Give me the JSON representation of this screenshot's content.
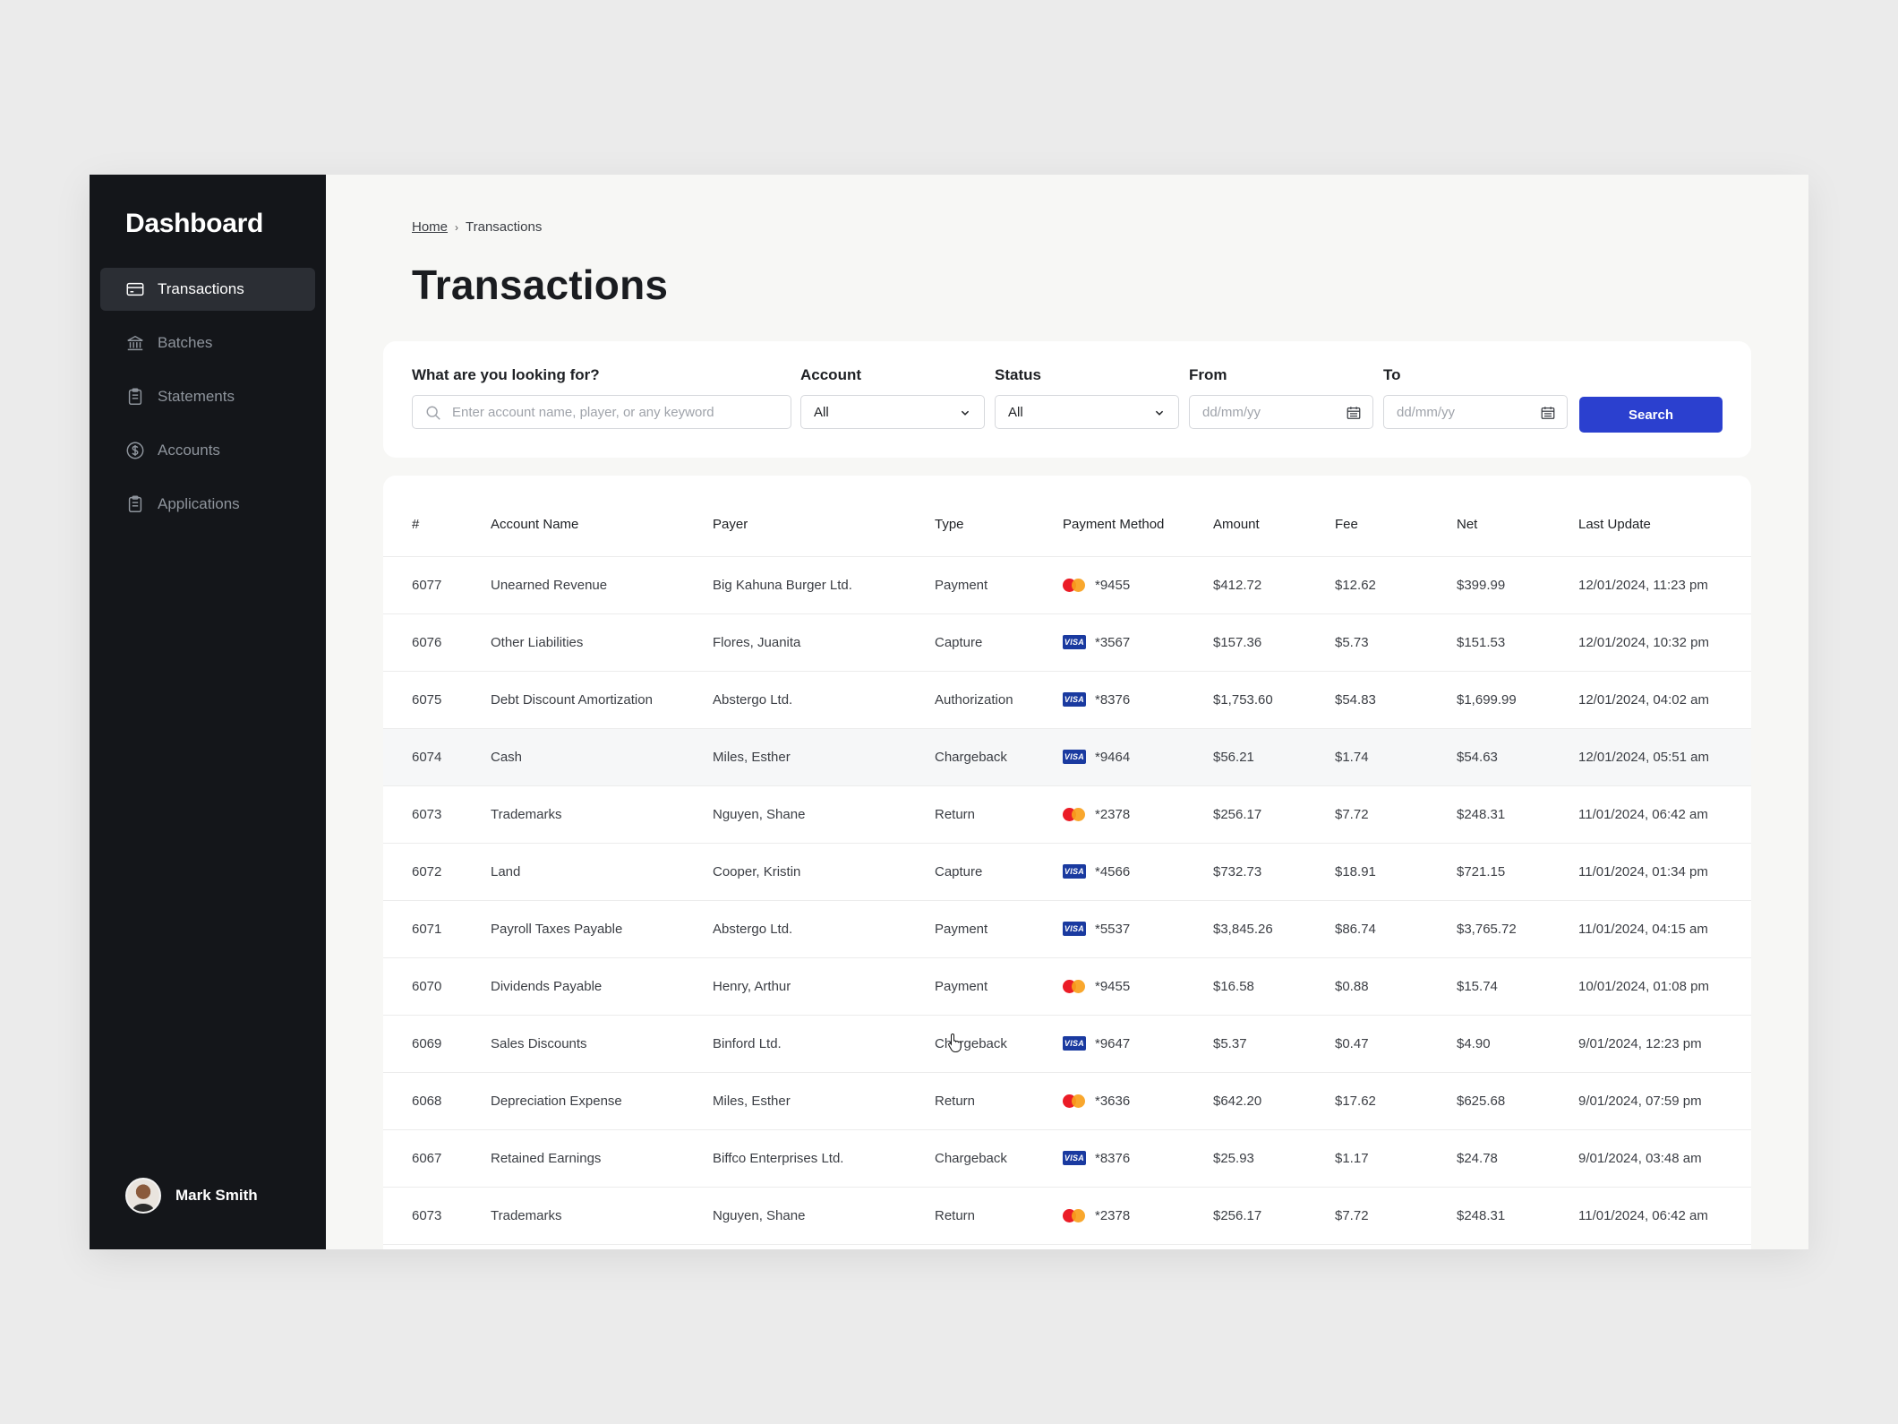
{
  "sidebar": {
    "brand": "Dashboard",
    "items": [
      {
        "label": "Transactions",
        "icon": "card-icon",
        "active": true
      },
      {
        "label": "Batches",
        "icon": "bank-icon",
        "active": false
      },
      {
        "label": "Statements",
        "icon": "clipboard-icon",
        "active": false
      },
      {
        "label": "Accounts",
        "icon": "dollar-circle-icon",
        "active": false
      },
      {
        "label": "Applications",
        "icon": "clipboard-icon",
        "active": false
      }
    ],
    "user": {
      "name": "Mark Smith"
    }
  },
  "breadcrumb": {
    "home": "Home",
    "current": "Transactions"
  },
  "page_title": "Transactions",
  "filters": {
    "search": {
      "label": "What are you looking for?",
      "placeholder": "Enter account name, player, or any keyword",
      "value": ""
    },
    "account": {
      "label": "Account",
      "value": "All"
    },
    "status": {
      "label": "Status",
      "value": "All"
    },
    "from": {
      "label": "From",
      "placeholder": "dd/mm/yy"
    },
    "to": {
      "label": "To",
      "placeholder": "dd/mm/yy"
    },
    "search_button": "Search"
  },
  "table": {
    "columns": [
      "#",
      "Account Name",
      "Payer",
      "Type",
      "Payment Method",
      "Amount",
      "Fee",
      "Net",
      "Last Update"
    ],
    "rows": [
      {
        "id": "6077",
        "account": "Unearned Revenue",
        "payer": "Big Kahuna Burger Ltd.",
        "type": "Payment",
        "card": "mastercard",
        "last4": "*9455",
        "amount": "$412.72",
        "fee": "$12.62",
        "net": "$399.99",
        "updated": "12/01/2024, 11:23 pm"
      },
      {
        "id": "6076",
        "account": "Other Liabilities",
        "payer": "Flores, Juanita",
        "type": "Capture",
        "card": "visa",
        "last4": "*3567",
        "amount": "$157.36",
        "fee": "$5.73",
        "net": "$151.53",
        "updated": "12/01/2024, 10:32 pm"
      },
      {
        "id": "6075",
        "account": "Debt Discount Amortization",
        "payer": "Abstergo Ltd.",
        "type": "Authorization",
        "card": "visa",
        "last4": "*8376",
        "amount": "$1,753.60",
        "fee": "$54.83",
        "net": "$1,699.99",
        "updated": "12/01/2024, 04:02 am"
      },
      {
        "id": "6074",
        "account": "Cash",
        "payer": "Miles, Esther",
        "type": "Chargeback",
        "card": "visa",
        "last4": "*9464",
        "amount": "$56.21",
        "fee": "$1.74",
        "net": "$54.63",
        "updated": "12/01/2024, 05:51 am",
        "hover": true
      },
      {
        "id": "6073",
        "account": "Trademarks",
        "payer": "Nguyen, Shane",
        "type": "Return",
        "card": "mastercard",
        "last4": "*2378",
        "amount": "$256.17",
        "fee": "$7.72",
        "net": "$248.31",
        "updated": "11/01/2024, 06:42 am"
      },
      {
        "id": "6072",
        "account": "Land",
        "payer": "Cooper, Kristin",
        "type": "Capture",
        "card": "visa",
        "last4": "*4566",
        "amount": "$732.73",
        "fee": "$18.91",
        "net": "$721.15",
        "updated": "11/01/2024, 01:34 pm"
      },
      {
        "id": "6071",
        "account": "Payroll Taxes Payable",
        "payer": "Abstergo Ltd.",
        "type": "Payment",
        "card": "visa",
        "last4": "*5537",
        "amount": "$3,845.26",
        "fee": "$86.74",
        "net": "$3,765.72",
        "updated": "11/01/2024, 04:15 am"
      },
      {
        "id": "6070",
        "account": "Dividends Payable",
        "payer": "Henry, Arthur",
        "type": "Payment",
        "card": "mastercard",
        "last4": "*9455",
        "amount": "$16.58",
        "fee": "$0.88",
        "net": "$15.74",
        "updated": "10/01/2024, 01:08 pm"
      },
      {
        "id": "6069",
        "account": "Sales Discounts",
        "payer": "Binford Ltd.",
        "type": "Chargeback",
        "card": "visa",
        "last4": "*9647",
        "amount": "$5.37",
        "fee": "$0.47",
        "net": "$4.90",
        "updated": "9/01/2024, 12:23 pm"
      },
      {
        "id": "6068",
        "account": "Depreciation Expense",
        "payer": "Miles, Esther",
        "type": "Return",
        "card": "mastercard",
        "last4": "*3636",
        "amount": "$642.20",
        "fee": "$17.62",
        "net": "$625.68",
        "updated": "9/01/2024, 07:59 pm"
      },
      {
        "id": "6067",
        "account": "Retained Earnings",
        "payer": "Biffco Enterprises Ltd.",
        "type": "Chargeback",
        "card": "visa",
        "last4": "*8376",
        "amount": "$25.93",
        "fee": "$1.17",
        "net": "$24.78",
        "updated": "9/01/2024, 03:48 am"
      },
      {
        "id": "6073",
        "account": "Trademarks",
        "payer": "Nguyen, Shane",
        "type": "Return",
        "card": "mastercard",
        "last4": "*2378",
        "amount": "$256.17",
        "fee": "$7.72",
        "net": "$248.31",
        "updated": "11/01/2024, 06:42 am"
      }
    ]
  },
  "colors": {
    "sidebar_bg": "#14161a",
    "accent": "#2b40cf",
    "page_bg": "#f7f7f5"
  }
}
